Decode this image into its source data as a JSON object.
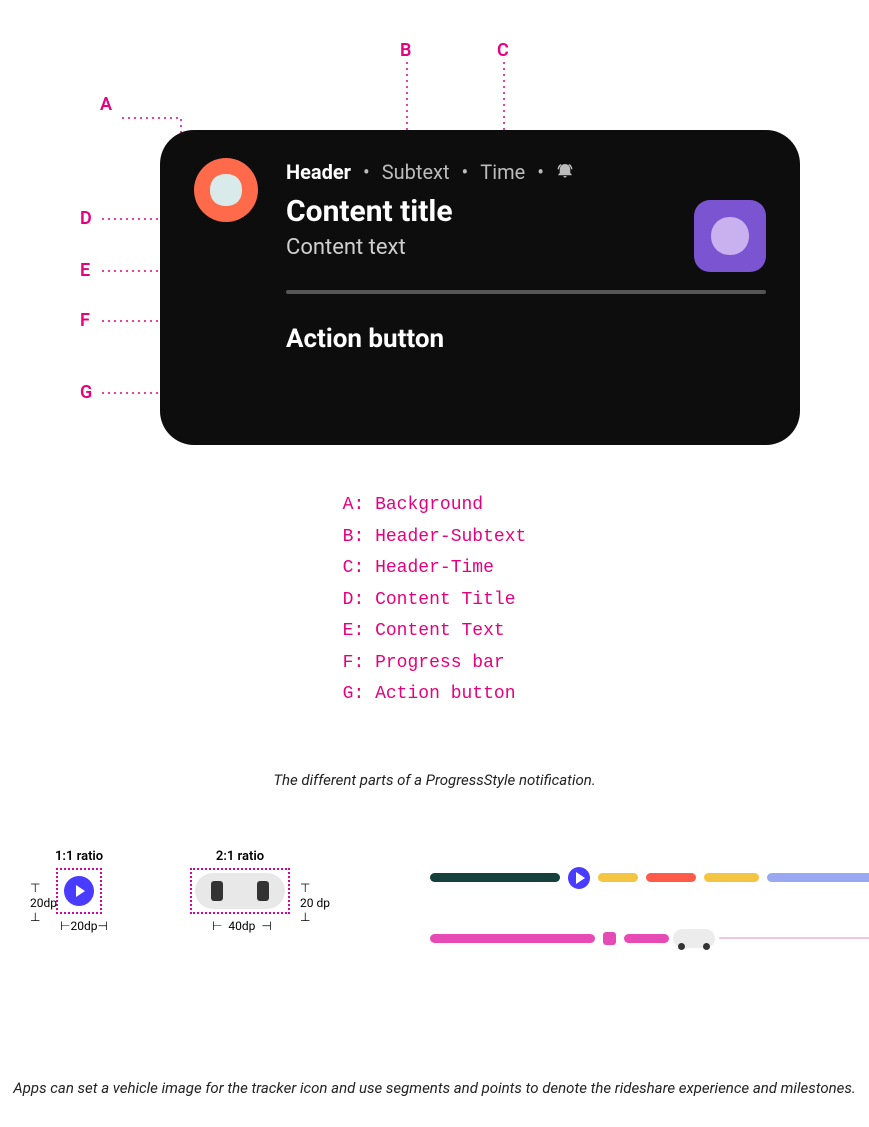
{
  "callouts": {
    "A": "A",
    "B": "B",
    "C": "C",
    "D": "D",
    "E": "E",
    "F": "F",
    "G": "G"
  },
  "notification": {
    "header_label": "Header",
    "subtext_label": "Subtext",
    "time_label": "Time",
    "content_title": "Content title",
    "content_text": "Content text",
    "action_button": "Action button"
  },
  "legend": {
    "A": "A: Background",
    "B": "B: Header-Subtext",
    "C": "C: Header-Time",
    "D": "D: Content Title",
    "E": "E: Content Text",
    "F": "F: Progress bar",
    "G": "G: Action button"
  },
  "caption1": "The different parts of a ProgressStyle notification.",
  "ratios": {
    "one_one": "1:1 ratio",
    "two_one": "2:1 ratio",
    "dim20dp": "20dp",
    "dim20_dp_sp": "20 dp",
    "dim40dp": "40dp"
  },
  "caption2": "Apps can set a vehicle image for the tracker icon and use segments and points to denote the rideshare experience and milestones."
}
